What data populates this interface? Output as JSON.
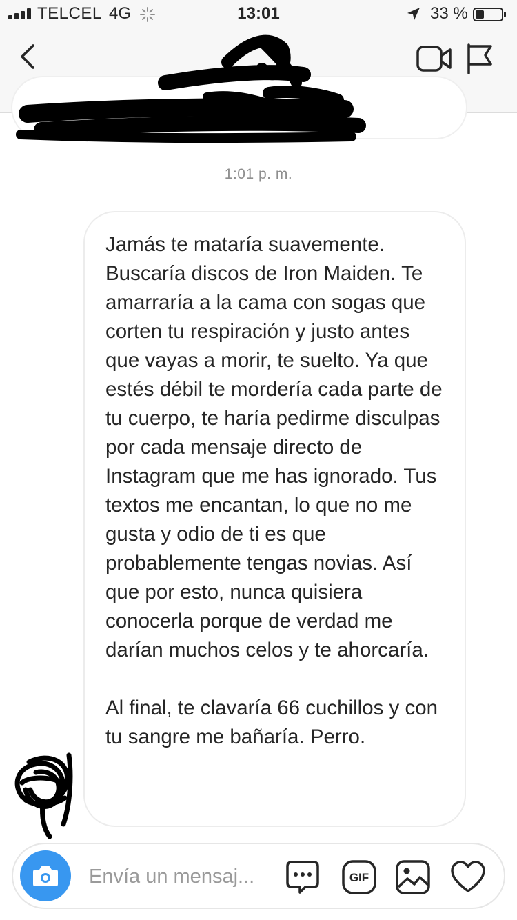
{
  "status_bar": {
    "carrier": "TELCEL",
    "network": "4G",
    "time": "13:01",
    "battery_percent": "33 %",
    "battery_level": 0.33
  },
  "header": {
    "icons": [
      "back-icon",
      "video-call-icon",
      "flag-icon"
    ]
  },
  "conversation": {
    "timestamp": "1:01 p. m.",
    "message": {
      "paragraphs": [
        "Jamás te mataría suavemente. Buscaría discos de Iron Maiden. Te amarraría a la cama con sogas que corten tu respiración y justo antes que vayas a morir, te suelto. Ya que estés débil te mordería cada parte de tu cuerpo, te haría pedirme disculpas por cada mensaje directo de Instagram que me has ignorado. Tus textos me encantan, lo que no me gusta y odio de ti es que probablemente tengas novias. Así que por esto, nunca quisiera conocerla porque de verdad me darían muchos celos y te ahorcaría.",
        "Al final, te clavaría 66 cuchillos y con tu sangre me bañaría. Perro."
      ]
    }
  },
  "composer": {
    "placeholder": "Envía un mensaj...",
    "gif_label": "GIF",
    "accent_color": "#3897f0",
    "icons": [
      "camera-icon",
      "chat-bubble-icon",
      "gif-icon",
      "gallery-icon",
      "heart-icon"
    ]
  }
}
